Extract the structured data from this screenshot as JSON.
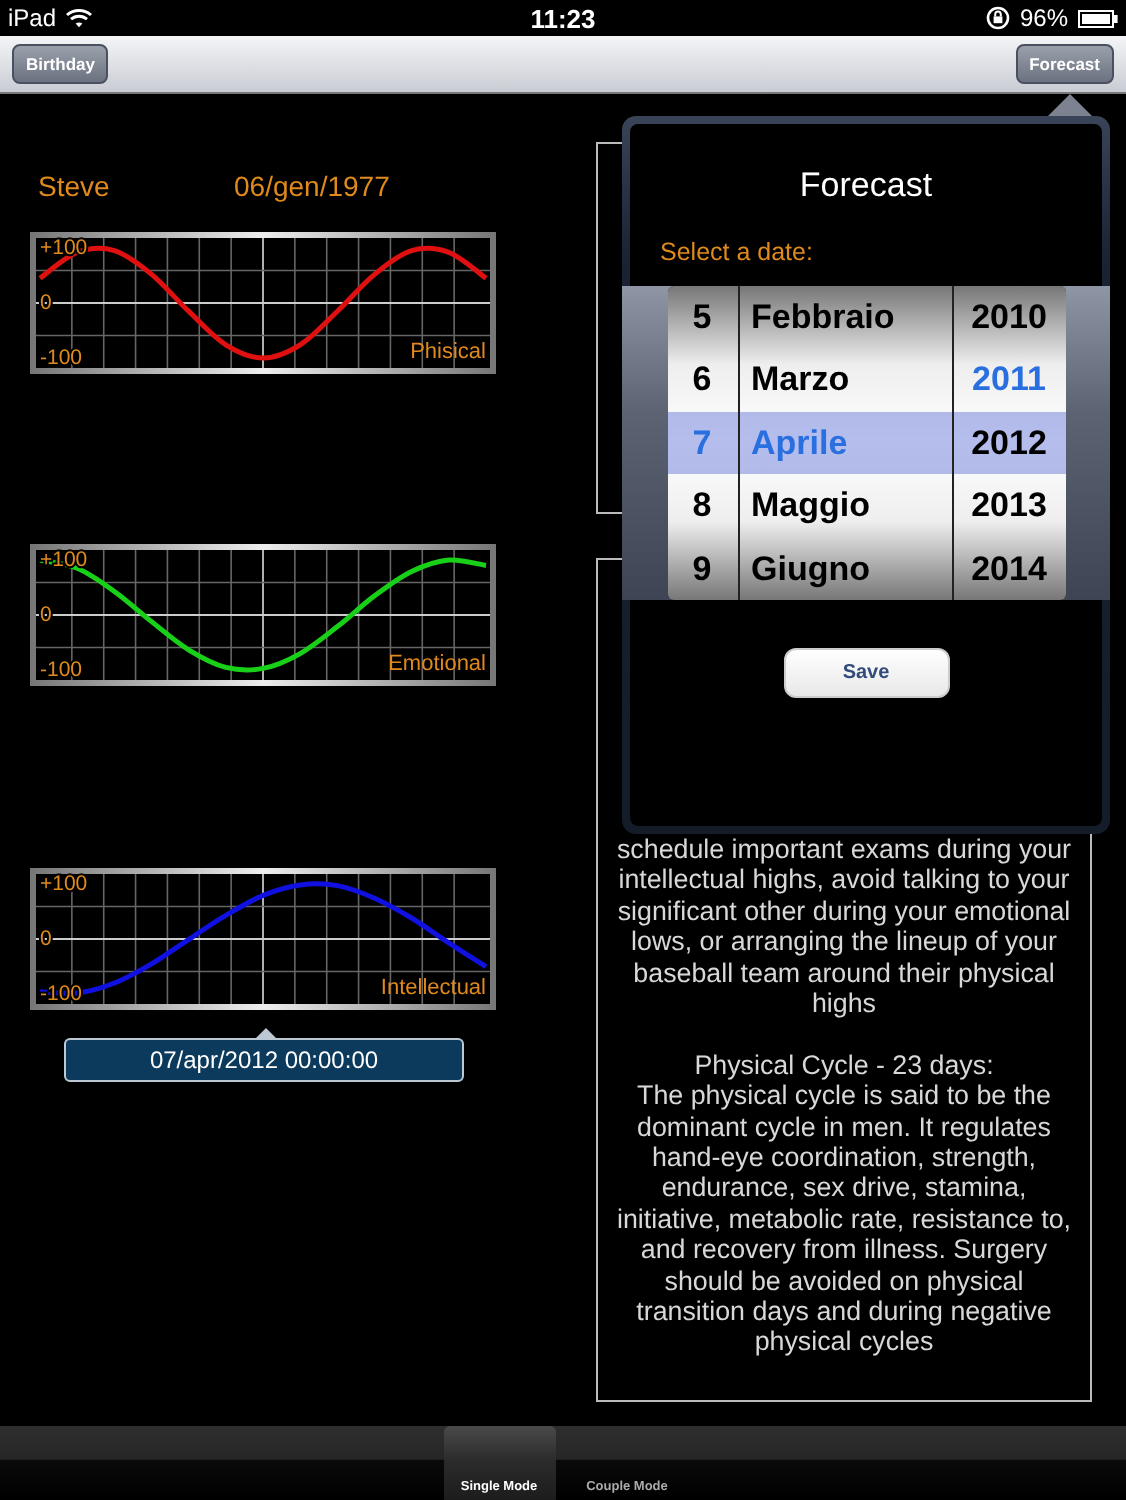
{
  "status_bar": {
    "device": "iPad",
    "time": "11:23",
    "battery": "96%"
  },
  "nav_bar": {
    "left_button": "Birthday",
    "right_button": "Forecast"
  },
  "person": {
    "name": "Steve",
    "birth_date": "06/gen/1977"
  },
  "charts": [
    {
      "chart_data": {
        "type": "line",
        "title": "Phisical",
        "ylim": [
          -118,
          118
        ],
        "yticks": [
          {
            "value": 100,
            "label": "+100"
          },
          {
            "value": 0,
            "label": "0"
          },
          {
            "value": -100,
            "label": "-100"
          }
        ],
        "series": [
          {
            "color": "#e01010",
            "values": [
              45,
              92,
              95,
              52,
              -15,
              -76,
              -100,
              -76,
              -15,
              52,
              95,
              92,
              45
            ]
          }
        ]
      }
    },
    {
      "chart_data": {
        "type": "line",
        "title": "Emotional",
        "ylim": [
          -118,
          118
        ],
        "yticks": [
          {
            "value": 100,
            "label": "+100"
          },
          {
            "value": 0,
            "label": "0"
          },
          {
            "value": -100,
            "label": "-100"
          }
        ],
        "series": [
          {
            "color": "#18d018",
            "values": [
              100,
              85,
              43,
              -12,
              -63,
              -95,
              -97,
              -70,
              -21,
              35,
              79,
              100,
              90
            ]
          }
        ]
      }
    },
    {
      "chart_data": {
        "type": "line",
        "title": "Intellectual",
        "ylim": [
          -118,
          118
        ],
        "yticks": [
          {
            "value": 100,
            "label": "+100"
          },
          {
            "value": 0,
            "label": "0"
          },
          {
            "value": -100,
            "label": "-100"
          }
        ],
        "series": [
          {
            "color": "#1010e0",
            "values": [
              -96,
              -98,
              -80,
              -45,
              -1,
              43,
              79,
              98,
              97,
              74,
              38,
              -7,
              -50
            ]
          }
        ]
      }
    }
  ],
  "selected_date": "07/apr/2012 00:00:00",
  "description": {
    "paragraphs": [
      {
        "kind": "text",
        "text": "schedule important exams during your intellectual highs, avoid talking to your significant other during your emotional lows, or arranging the lineup of your baseball team around their physical highs"
      },
      {
        "kind": "heading",
        "text": "Physical Cycle - 23 days:"
      },
      {
        "kind": "text",
        "text": "The physical cycle is said to be the dominant cycle in men. It regulates hand-eye coordination, strength, endurance, sex drive, stamina, initiative, metabolic rate, resistance to, and recovery from illness. Surgery should be avoided on physical transition days and during negative physical cycles"
      }
    ]
  },
  "popover": {
    "title": "Forecast",
    "prompt": "Select a date:",
    "save_button": "Save",
    "columns": [
      {
        "kind": "day",
        "items": [
          {
            "text": "5",
            "selected": false,
            "highlighted": false
          },
          {
            "text": "6",
            "selected": false,
            "highlighted": false
          },
          {
            "text": "7",
            "selected": true,
            "highlighted": true
          },
          {
            "text": "8",
            "selected": false,
            "highlighted": false
          },
          {
            "text": "9",
            "selected": false,
            "highlighted": false
          }
        ]
      },
      {
        "kind": "month",
        "items": [
          {
            "text": "Febbraio",
            "selected": false,
            "highlighted": false
          },
          {
            "text": "Marzo",
            "selected": false,
            "highlighted": false
          },
          {
            "text": "Aprile",
            "selected": true,
            "highlighted": true
          },
          {
            "text": "Maggio",
            "selected": false,
            "highlighted": false
          },
          {
            "text": "Giugno",
            "selected": false,
            "highlighted": false
          }
        ]
      },
      {
        "kind": "year",
        "items": [
          {
            "text": "2010",
            "selected": false,
            "highlighted": false
          },
          {
            "text": "2011",
            "selected": false,
            "highlighted": true
          },
          {
            "text": "2012",
            "selected": true,
            "highlighted": false
          },
          {
            "text": "2013",
            "selected": false,
            "highlighted": false
          },
          {
            "text": "2014",
            "selected": false,
            "highlighted": false
          }
        ]
      }
    ]
  },
  "tab_bar": {
    "tabs": [
      {
        "label": "Single Mode",
        "selected": true
      },
      {
        "label": "Couple Mode",
        "selected": false
      }
    ]
  }
}
